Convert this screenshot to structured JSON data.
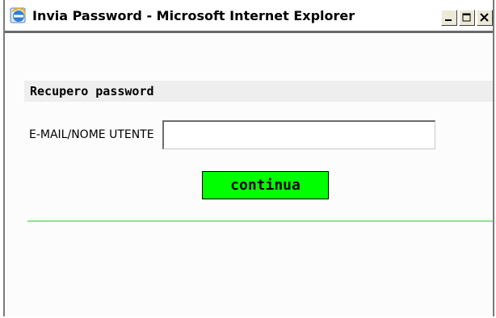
{
  "window": {
    "title": "Invia Password - Microsoft Internet Explorer",
    "icon": "internet-explorer-icon",
    "buttons": [
      "minimize",
      "maximize",
      "close"
    ]
  },
  "form": {
    "section_title": "Recupero password",
    "field_label": "E-MAIL/NOME UTENTE",
    "field_value": "",
    "submit_label": "continua"
  },
  "colors": {
    "button_bg": "#00ff00",
    "divider": "#8fe58f",
    "section_bg": "#eeeeee"
  }
}
